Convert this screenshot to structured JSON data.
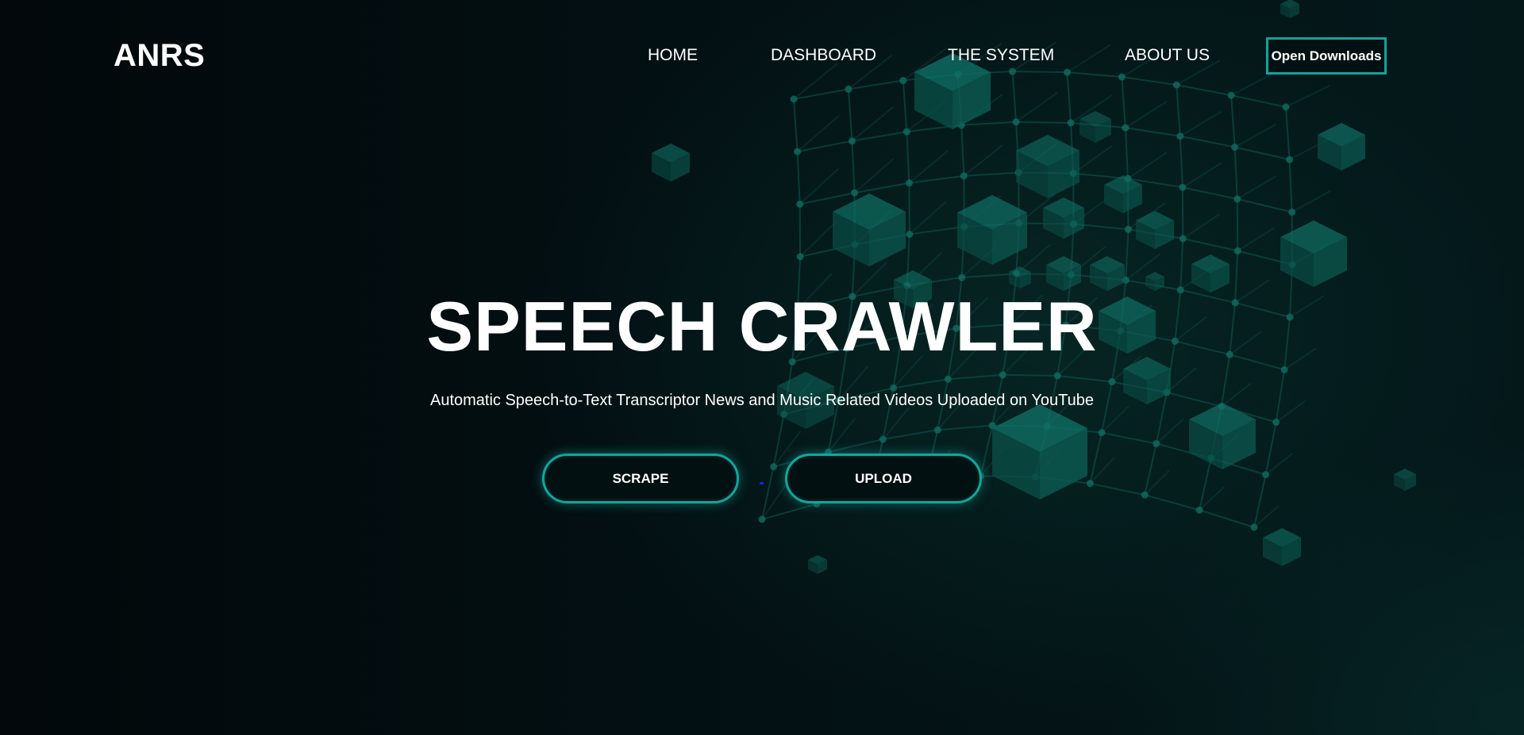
{
  "brand": "ANRS",
  "nav": {
    "items": [
      "HOME",
      "DASHBOARD",
      "THE SYSTEM",
      "ABOUT US"
    ],
    "download_label": "Open Downloads"
  },
  "hero": {
    "title": "SPEECH CRAWLER",
    "subtitle": "Automatic Speech-to-Text Transcriptor News and Music Related Videos Uploaded on YouTube",
    "buttons": [
      "SCRAPE",
      "UPLOAD"
    ]
  },
  "colors": {
    "accent": "#14a39a",
    "background": "#020b0e",
    "text": "#ffffff"
  }
}
